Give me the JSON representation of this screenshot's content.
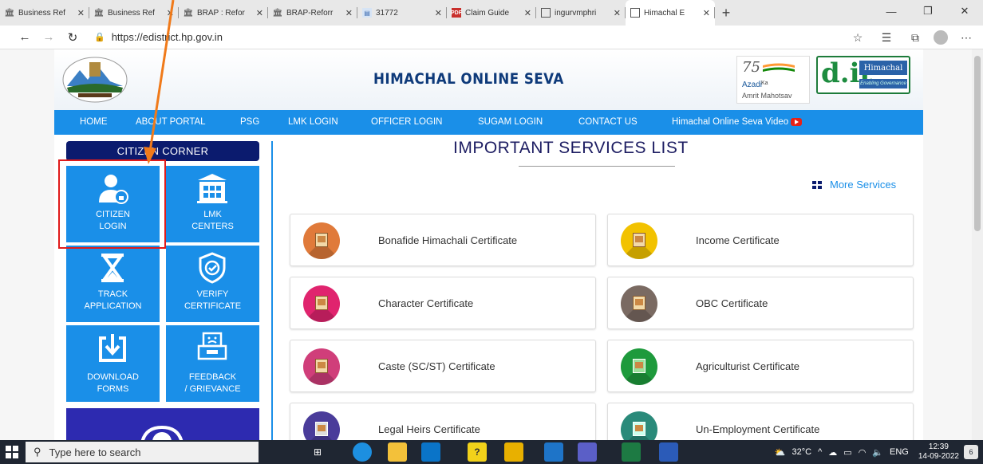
{
  "browser": {
    "tabs": [
      {
        "title": "Business Ref",
        "icon": "bank-icon"
      },
      {
        "title": "Business Ref",
        "icon": "bank-icon"
      },
      {
        "title": "BRAP : Refor",
        "icon": "bank-icon"
      },
      {
        "title": "BRAP-Reforr",
        "icon": "bank-icon"
      },
      {
        "title": "31772",
        "icon": "doc-icon"
      },
      {
        "title": "Claim Guide",
        "icon": "pdf-icon"
      },
      {
        "title": "ingurvmphri",
        "icon": "page-icon"
      },
      {
        "title": "Himachal E",
        "icon": "page-icon"
      }
    ],
    "active_tab": 7,
    "url": "https://edistrict.hp.gov.in"
  },
  "header": {
    "site_title": "HIMACHAL ONLINE SEVA",
    "azadi_75": "75",
    "azadi_word": "Azadi",
    "azadi_ka": "Ka",
    "azadi_amrit": "Amrit Mahotsav",
    "dit_logo": "d.it",
    "dit_state": "Himachal",
    "dit_tagline": "Enabling Governance"
  },
  "nav": {
    "items": [
      "HOME",
      "ABOUT PORTAL",
      "PSG",
      "LMK LOGIN",
      "OFFICER LOGIN",
      "SUGAM LOGIN",
      "CONTACT US",
      "Himachal Online Seva Video"
    ]
  },
  "citizen_corner": {
    "heading": "CITIZEN CORNER",
    "tiles": [
      {
        "label1": "CITIZEN",
        "label2": "LOGIN",
        "icon": "user-lock-icon"
      },
      {
        "label1": "LMK",
        "label2": "CENTERS",
        "icon": "building-icon"
      },
      {
        "label1": "TRACK",
        "label2": "APPLICATION",
        "icon": "hourglass-icon"
      },
      {
        "label1": "VERIFY",
        "label2": "CERTIFICATE",
        "icon": "shield-check-icon"
      },
      {
        "label1": "DOWNLOAD",
        "label2": "FORMS",
        "icon": "download-icon"
      },
      {
        "label1": "FEEDBACK",
        "label2": "/ GRIEVANCE",
        "icon": "feedback-icon"
      }
    ]
  },
  "services": {
    "title": "IMPORTANT SERVICES LIST",
    "more_label": "More Services",
    "items": [
      {
        "name": "Bonafide Himachali Certificate",
        "color": "#e07a3a"
      },
      {
        "name": "Income Certificate",
        "color": "#f2c200"
      },
      {
        "name": "Character Certificate",
        "color": "#e0246e"
      },
      {
        "name": "OBC Certificate",
        "color": "#7a6a62"
      },
      {
        "name": "Caste (SC/ST) Certificate",
        "color": "#d03e7a"
      },
      {
        "name": "Agriculturist Certificate",
        "color": "#1e9a3c"
      },
      {
        "name": "Legal Heirs Certificate",
        "color": "#4a3c9a"
      },
      {
        "name": "Un-Employment Certificate",
        "color": "#2a8a7a"
      }
    ]
  },
  "taskbar": {
    "search_placeholder": "Type here to search",
    "temperature": "32°C",
    "language": "ENG",
    "time": "12:39",
    "date": "14-09-2022",
    "notification_count": "6"
  }
}
